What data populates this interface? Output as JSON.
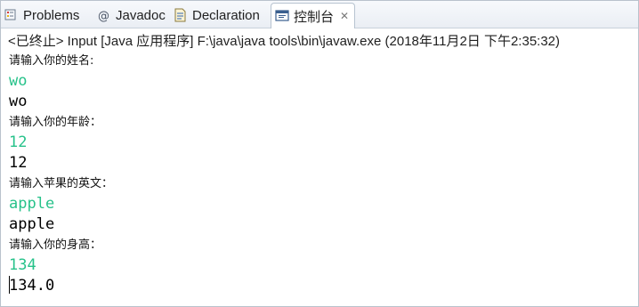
{
  "tabs": [
    {
      "label": "Problems",
      "icon": "problems-icon"
    },
    {
      "label": "Javadoc",
      "icon": "at-sign-icon"
    },
    {
      "label": "Declaration",
      "icon": "declaration-icon"
    },
    {
      "label": "控制台",
      "icon": "console-icon",
      "active": true,
      "close": "✕"
    }
  ],
  "status": "<已终止> Input [Java 应用程序] F:\\java\\java tools\\bin\\javaw.exe  (2018年11月2日 下午2:35:32)",
  "console": {
    "lines": [
      {
        "type": "prompt",
        "text": "请输入你的姓名:"
      },
      {
        "type": "input",
        "text": "wo"
      },
      {
        "type": "output",
        "text": "wo"
      },
      {
        "type": "prompt",
        "text": "请输入你的年龄："
      },
      {
        "type": "input",
        "text": "12"
      },
      {
        "type": "output",
        "text": "12"
      },
      {
        "type": "prompt",
        "text": "请输入苹果的英文："
      },
      {
        "type": "input",
        "text": "apple"
      },
      {
        "type": "output",
        "text": "apple"
      },
      {
        "type": "prompt",
        "text": "请输入你的身高："
      },
      {
        "type": "input",
        "text": "134"
      },
      {
        "type": "output",
        "text": "134.0"
      }
    ]
  },
  "colors": {
    "input_text": "#27c28a",
    "output_text": "#000000",
    "tab_border": "#b7c3d0"
  }
}
